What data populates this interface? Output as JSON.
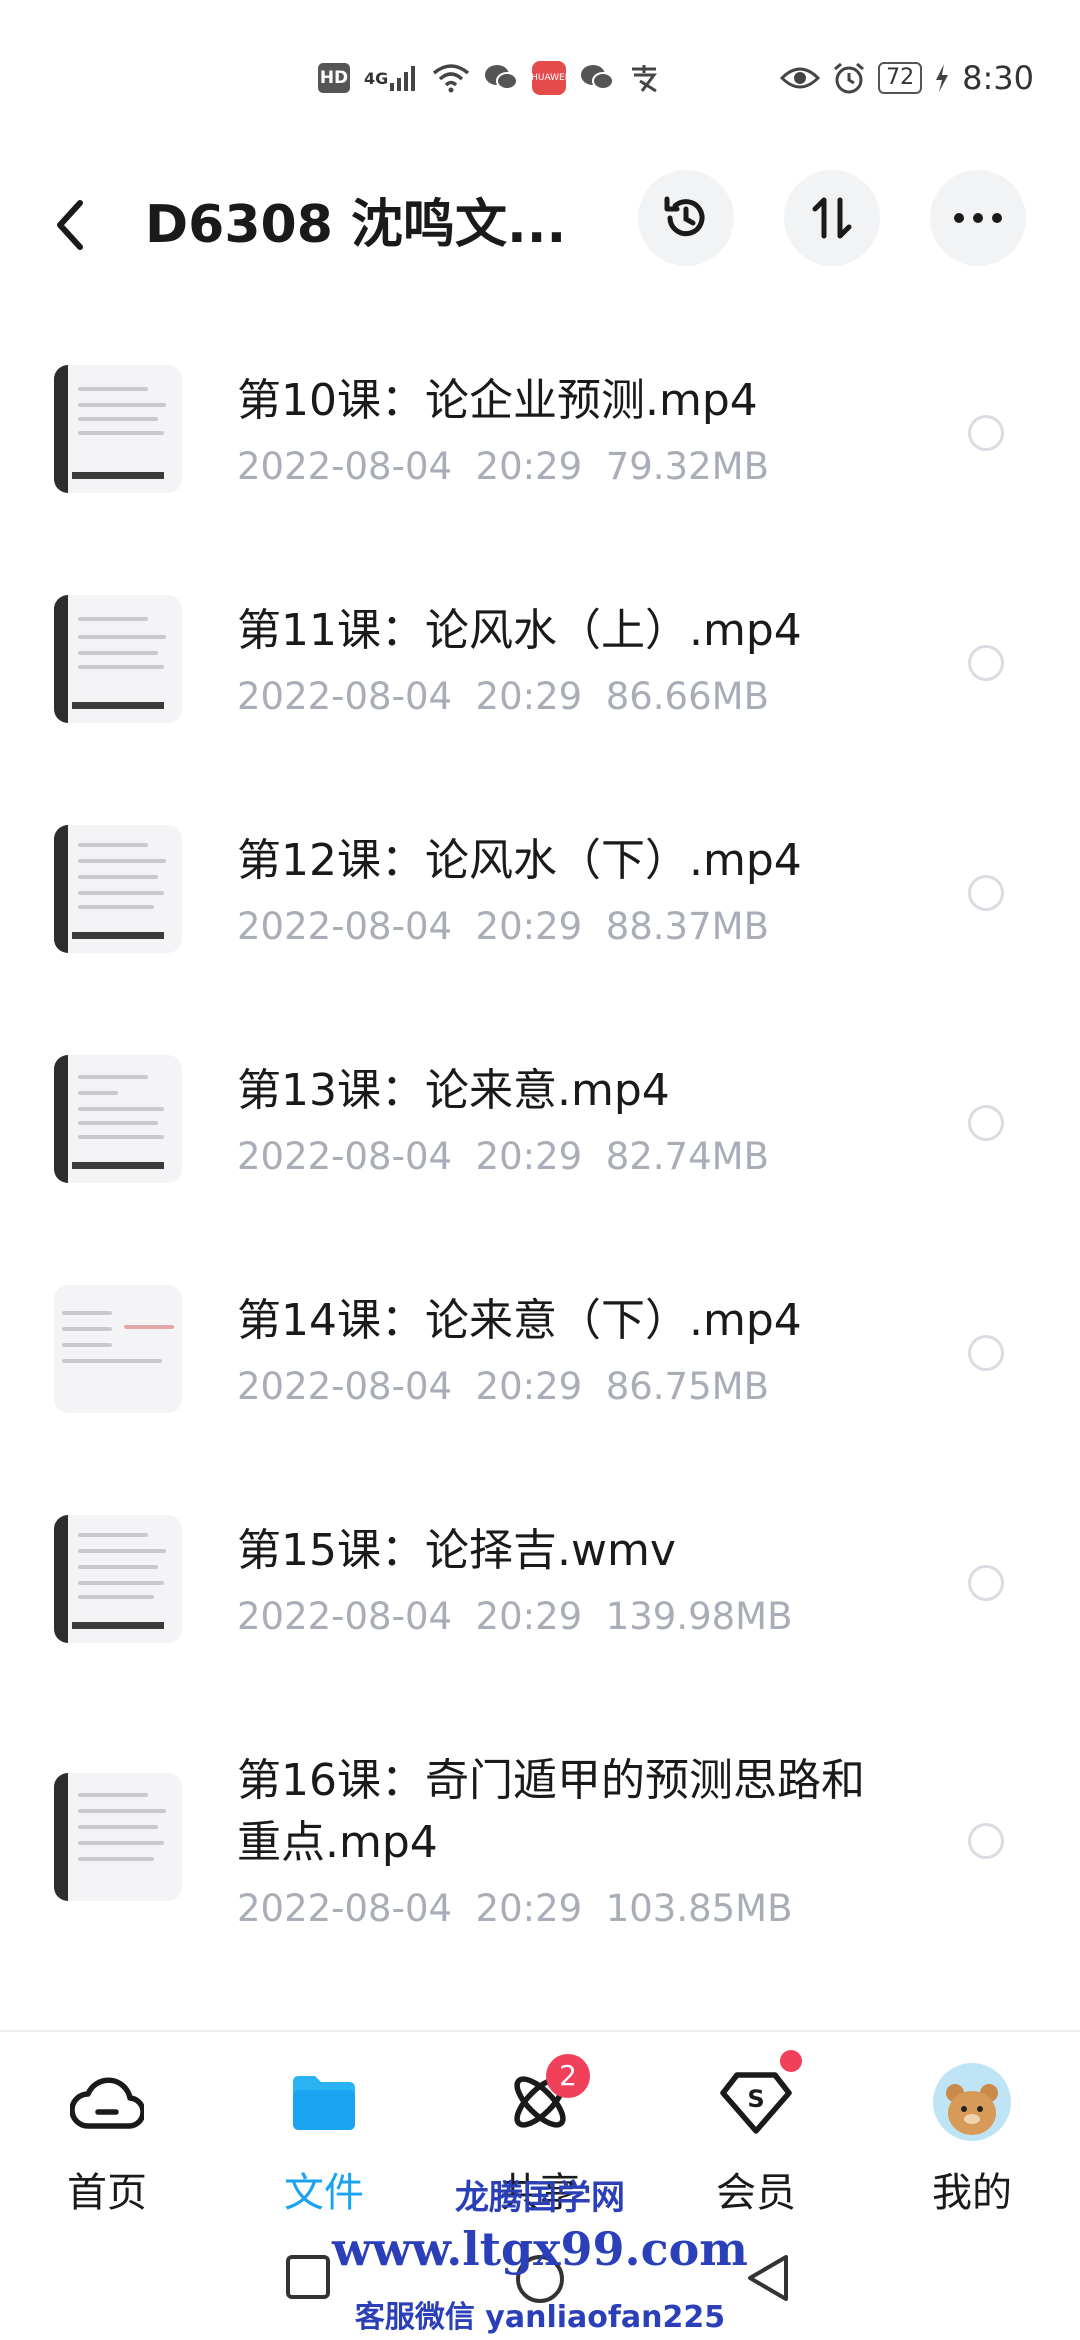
{
  "status_bar": {
    "left_icons": [
      "hd-icon",
      "signal-4g-icon",
      "wifi-icon",
      "wechat-icon",
      "huawei-app-icon",
      "wechat-icon",
      "alipay-icon"
    ],
    "hd_label": "HD",
    "network_label": "4G",
    "battery": "72",
    "time": "8:30"
  },
  "header": {
    "title": "D6308 沈鸣文..."
  },
  "files": [
    {
      "name": "第10课：论企业预测.mp4",
      "date": "2022-08-04  20:29",
      "size": "79.32MB"
    },
    {
      "name": "第11课：论风水（上）.mp4",
      "date": "2022-08-04  20:29",
      "size": "86.66MB"
    },
    {
      "name": "第12课：论风水（下）.mp4",
      "date": "2022-08-04  20:29",
      "size": "88.37MB"
    },
    {
      "name": "第13课：论来意.mp4",
      "date": "2022-08-04  20:29",
      "size": "82.74MB"
    },
    {
      "name": "第14课：论来意（下）.mp4",
      "date": "2022-08-04  20:29",
      "size": "86.75MB"
    },
    {
      "name": "第15课：论择吉.wmv",
      "date": "2022-08-04  20:29",
      "size": "139.98MB"
    },
    {
      "name": "第16课：奇门遁甲的预测思路和重点.mp4",
      "date": "2022-08-04  20:29",
      "size": "103.85MB"
    }
  ],
  "bottom_nav": [
    {
      "label": "首页",
      "icon": "home-cloud-icon",
      "active": false
    },
    {
      "label": "文件",
      "icon": "folder-icon",
      "active": true
    },
    {
      "label": "共享",
      "icon": "share-atom-icon",
      "active": false,
      "badge": "2"
    },
    {
      "label": "会员",
      "icon": "vip-shield-icon",
      "active": false,
      "dot": true
    },
    {
      "label": "我的",
      "icon": "avatar",
      "active": false
    }
  ],
  "watermark": {
    "line1": "龙腾国学网",
    "line2": "www.ltgx99.com",
    "line3": "客服微信 yanliaofan225"
  },
  "colors": {
    "accent": "#1aa3f0",
    "badge": "#f0405a",
    "meta_text": "#a8adb7"
  }
}
